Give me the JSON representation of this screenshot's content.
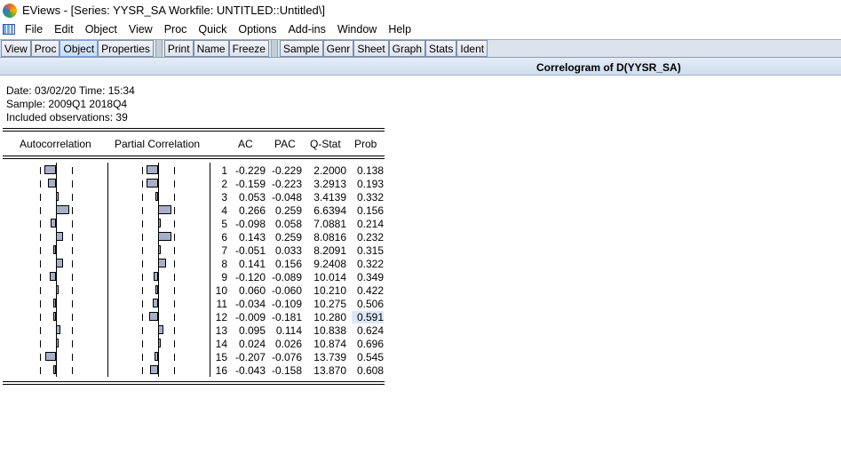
{
  "window_title": "EViews - [Series: YYSR_SA    Workfile: UNTITLED::Untitled\\]",
  "menu": [
    "File",
    "Edit",
    "Object",
    "View",
    "Proc",
    "Quick",
    "Options",
    "Add-ins",
    "Window",
    "Help"
  ],
  "toolbar": [
    [
      "View",
      "Proc",
      "Object",
      "Properties"
    ],
    [
      "Print",
      "Name",
      "Freeze"
    ],
    [
      "Sample",
      "Genr",
      "Sheet",
      "Graph",
      "Stats",
      "Ident"
    ]
  ],
  "view_title": "Correlogram of D(YYSR_SA)",
  "info": {
    "date": "Date: 03/02/20   Time: 15:34",
    "sample": "Sample: 2009Q1 2018Q4",
    "obs": "Included observations: 39"
  },
  "headers": {
    "ac_graph": "Autocorrelation",
    "pac_graph": "Partial Correlation",
    "ac": "AC",
    "pac": "PAC",
    "q": "Q-Stat",
    "prob": "Prob"
  },
  "rows": [
    [
      "1",
      "-0.229",
      "-0.229",
      "2.2000",
      "0.138"
    ],
    [
      "2",
      "-0.159",
      "-0.223",
      "3.2913",
      "0.193"
    ],
    [
      "3",
      "0.053",
      "-0.048",
      "3.4139",
      "0.332"
    ],
    [
      "4",
      "0.266",
      "0.259",
      "6.6394",
      "0.156"
    ],
    [
      "5",
      "-0.098",
      "0.058",
      "7.0881",
      "0.214"
    ],
    [
      "6",
      "0.143",
      "0.259",
      "8.0816",
      "0.232"
    ],
    [
      "7",
      "-0.051",
      "0.033",
      "8.2091",
      "0.315"
    ],
    [
      "8",
      "0.141",
      "0.156",
      "9.2408",
      "0.322"
    ],
    [
      "9",
      "-0.120",
      "-0.089",
      "10.014",
      "0.349"
    ],
    [
      "10",
      "0.060",
      "-0.060",
      "10.210",
      "0.422"
    ],
    [
      "11",
      "-0.034",
      "-0.109",
      "10.275",
      "0.506"
    ],
    [
      "12",
      "-0.009",
      "-0.181",
      "10.280",
      "0.591"
    ],
    [
      "13",
      "0.095",
      "0.114",
      "10.838",
      "0.624"
    ],
    [
      "14",
      "0.024",
      "0.026",
      "10.874",
      "0.696"
    ],
    [
      "15",
      "-0.207",
      "-0.076",
      "13.739",
      "0.545"
    ],
    [
      "16",
      "-0.043",
      "-0.158",
      "13.870",
      "0.608"
    ]
  ],
  "selected_row": 11,
  "colors": {
    "bar": "#a7b0c8",
    "header": "#cfdcee"
  }
}
